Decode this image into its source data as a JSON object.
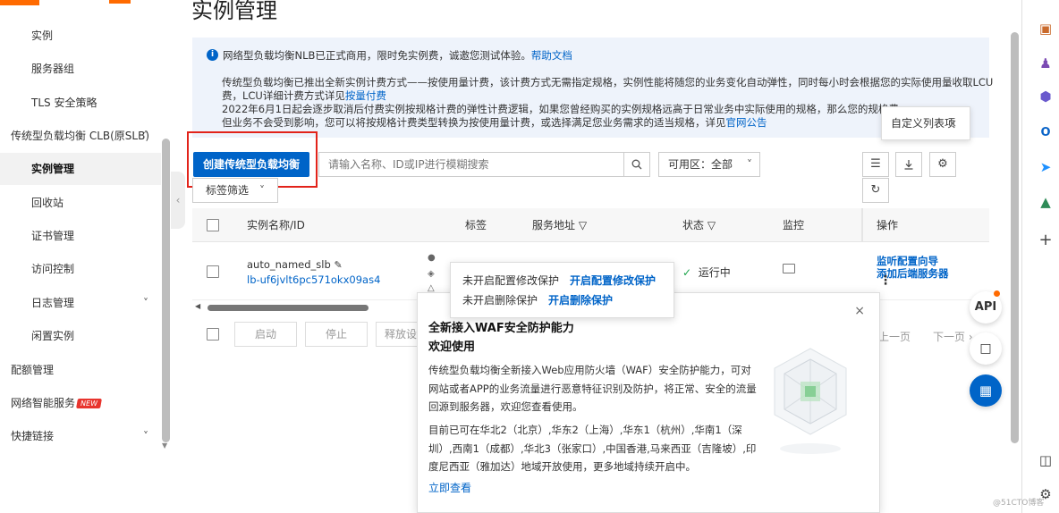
{
  "page_title": "实例管理",
  "sidebar": {
    "items": [
      {
        "label": "实例",
        "type": "sub"
      },
      {
        "label": "服务器组",
        "type": "sub"
      },
      {
        "label": "TLS 安全策略",
        "type": "sub"
      },
      {
        "label": "传统型负载均衡 CLB(原SLB)",
        "type": "top"
      },
      {
        "label": "实例管理",
        "type": "sub"
      },
      {
        "label": "回收站",
        "type": "sub"
      },
      {
        "label": "证书管理",
        "type": "sub"
      },
      {
        "label": "访问控制",
        "type": "sub"
      },
      {
        "label": "日志管理",
        "type": "sub"
      },
      {
        "label": "闲置实例",
        "type": "sub"
      },
      {
        "label": "配额管理",
        "type": "top"
      },
      {
        "label": "网络智能服务",
        "type": "top"
      },
      {
        "label": "快捷链接",
        "type": "top"
      }
    ],
    "new_badge": "NEW"
  },
  "notice": {
    "line1": "网络型负载均衡NLB已正式商用，限时免实例费，诚邀您测试体验。",
    "line1_link": "帮助文档",
    "line2": "传统型负载均衡已推出全新实例计费方式——按使用量计费，该计费方式无需指定规格，实例性能将随您的业务变化自动弹性，同时每小时会根据您的实际使用量收取LCU",
    "line3": "费，LCU详细计费方式详见",
    "line3_link": "按量付费",
    "line4": "2022年6月1日起会逐步取消后付费实例按规格计费的弹性计费逻辑，如果您曾经购买的实例规格远高于日常业务中实际使用的规格，那么您的规格费",
    "line5": "但业务不会受到影响，您可以将按规格计费类型转换为按使用量计费，或选择满足您业务需求的适当规格，详见",
    "line5_link": "官网公告"
  },
  "toolbar": {
    "create_label": "创建传统型负载均衡",
    "search_placeholder": "请输入名称、ID或IP进行模糊搜索",
    "zone_label": "可用区：全部",
    "tag_filter_label": "标签筛选",
    "custom_columns_tooltip": "自定义列表项"
  },
  "table": {
    "headers": {
      "name": "实例名称/ID",
      "tag": "标签",
      "address": "服务地址",
      "status": "状态",
      "monitor": "监控",
      "actions": "操作"
    },
    "rows": [
      {
        "name": "auto_named_slb",
        "id": "lb-uf6jvlt6pc571okx09as4",
        "status": "运行中",
        "action1": "监听配置向导",
        "action2": "添加后端服务器"
      }
    ]
  },
  "batch": {
    "start": "启动",
    "stop": "停止",
    "release": "释放设"
  },
  "pager": {
    "prev": "上一页",
    "next": "下一页"
  },
  "protect_popover": {
    "row1_text": "未开启配置修改保护",
    "row1_link": "开启配置修改保护",
    "row2_text": "未开启删除保护",
    "row2_link": "开启删除保护"
  },
  "waf_popover": {
    "title1": "全新接入WAF安全防护能力",
    "title2": "欢迎使用",
    "para1": "传统型负载均衡全新接入Web应用防火墙（WAF）安全防护能力，可对网站或者APP的业务流量进行恶意特征识别及防护，将正常、安全的流量回源到服务器，欢迎您查看使用。",
    "para2": "目前已可在华北2（北京）,华东2（上海）,华东1（杭州）,华南1（深圳）,西南1（成都）,华北3（张家口）,中国香港,马来西亚（吉隆坡）,印度尼西亚（雅加达）地域开放使用，更多地域持续开启中。",
    "link": "立即查看"
  },
  "float_buttons": {
    "api": "API"
  },
  "watermark": "@51CTO博客",
  "colors": {
    "primary": "#0064c8",
    "highlight_border": "#e2231a",
    "brand_orange": "#ff6a00",
    "success": "#1aa34a"
  }
}
